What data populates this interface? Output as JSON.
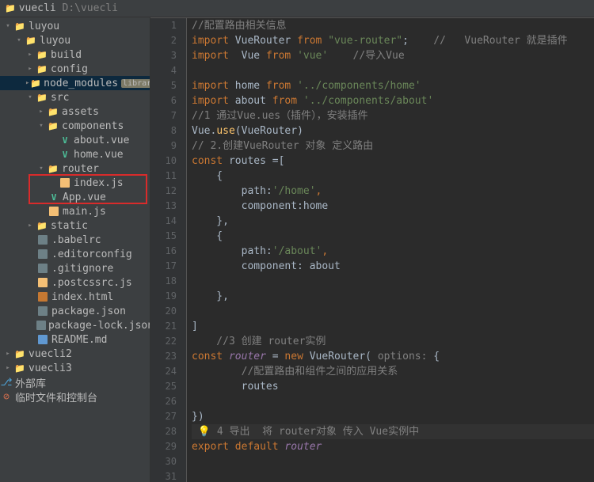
{
  "header": {
    "name": "vuecli",
    "path": "D:\\vuecli"
  },
  "tree": {
    "luyou": "luyou",
    "luyou_inner": "luyou",
    "build": "build",
    "config": "config",
    "node_modules": "node_modules",
    "node_modules_tag": "library",
    "src": "src",
    "assets": "assets",
    "components": "components",
    "about_vue": "about.vue",
    "home_vue": "home.vue",
    "router": "router",
    "index_js": "index.js",
    "app_vue": "App.vue",
    "main_js": "main.js",
    "static": "static",
    "babelrc": ".babelrc",
    "editorconfig": ".editorconfig",
    "gitignore": ".gitignore",
    "postcssrc": ".postcssrc.js",
    "index_html": "index.html",
    "package_json": "package.json",
    "package_lock": "package-lock.json",
    "readme": "README.md",
    "vuecli2": "vuecli2",
    "vuecli3": "vuecli3",
    "ext_lib": "外部库",
    "scratches": "临时文件和控制台"
  },
  "code": {
    "l1": {
      "cm": "//配置路由相关信息"
    },
    "l2": {
      "kw1": "import",
      "id1": "VueRouter",
      "kw2": "from",
      "str": "\"vue-router\"",
      "cm": "//   VueRouter 就是插件"
    },
    "l3": {
      "kw1": "import",
      "id1": "Vue",
      "kw2": "from",
      "str": "'vue'",
      "cm": "//导入Vue"
    },
    "l5": {
      "kw1": "import",
      "id1": "home",
      "kw2": "from",
      "str": "'../components/home'"
    },
    "l6": {
      "kw1": "import",
      "id1": "about",
      "kw2": "from",
      "str": "'../components/about'"
    },
    "l7": {
      "cm": "//1 通过Vue.ues（插件），安装插件"
    },
    "l8": {
      "id1": "Vue.",
      "fn": "use",
      "id2": "(VueRouter)"
    },
    "l9": {
      "cm": "// 2.创建VueRouter 对象 定义路由"
    },
    "l10": {
      "kw": "const",
      "id": " routes =["
    },
    "l11": {
      "t": "    {"
    },
    "l12": {
      "id": "        path:",
      "str": "'/home'",
      "p": ","
    },
    "l13": {
      "id": "        component:home"
    },
    "l14": {
      "t": "    },"
    },
    "l15": {
      "t": "    {"
    },
    "l16": {
      "id": "        path:",
      "str": "'/about'",
      "p": ","
    },
    "l17": {
      "id": "        component: about"
    },
    "l19": {
      "t": "    },"
    },
    "l21": {
      "t": "]"
    },
    "l22": {
      "cm": "    //3 创建 router实例"
    },
    "l23": {
      "kw1": "const",
      "id1": " ",
      "it": "router",
      "id2": " = ",
      "kw2": "new",
      "id3": " VueRouter( ",
      "cm": "options:",
      "id4": " {"
    },
    "l24": {
      "cm": "        //配置路由和组件之间的应用关系"
    },
    "l25": {
      "id": "        routes"
    },
    "l27": {
      "t": "})"
    },
    "l28": {
      "bulb": "💡",
      "cm": "4 导出  将 router对象 传入 Vue实例中"
    },
    "l29": {
      "kw1": "export",
      "kw2": "default",
      "it": "router"
    }
  }
}
